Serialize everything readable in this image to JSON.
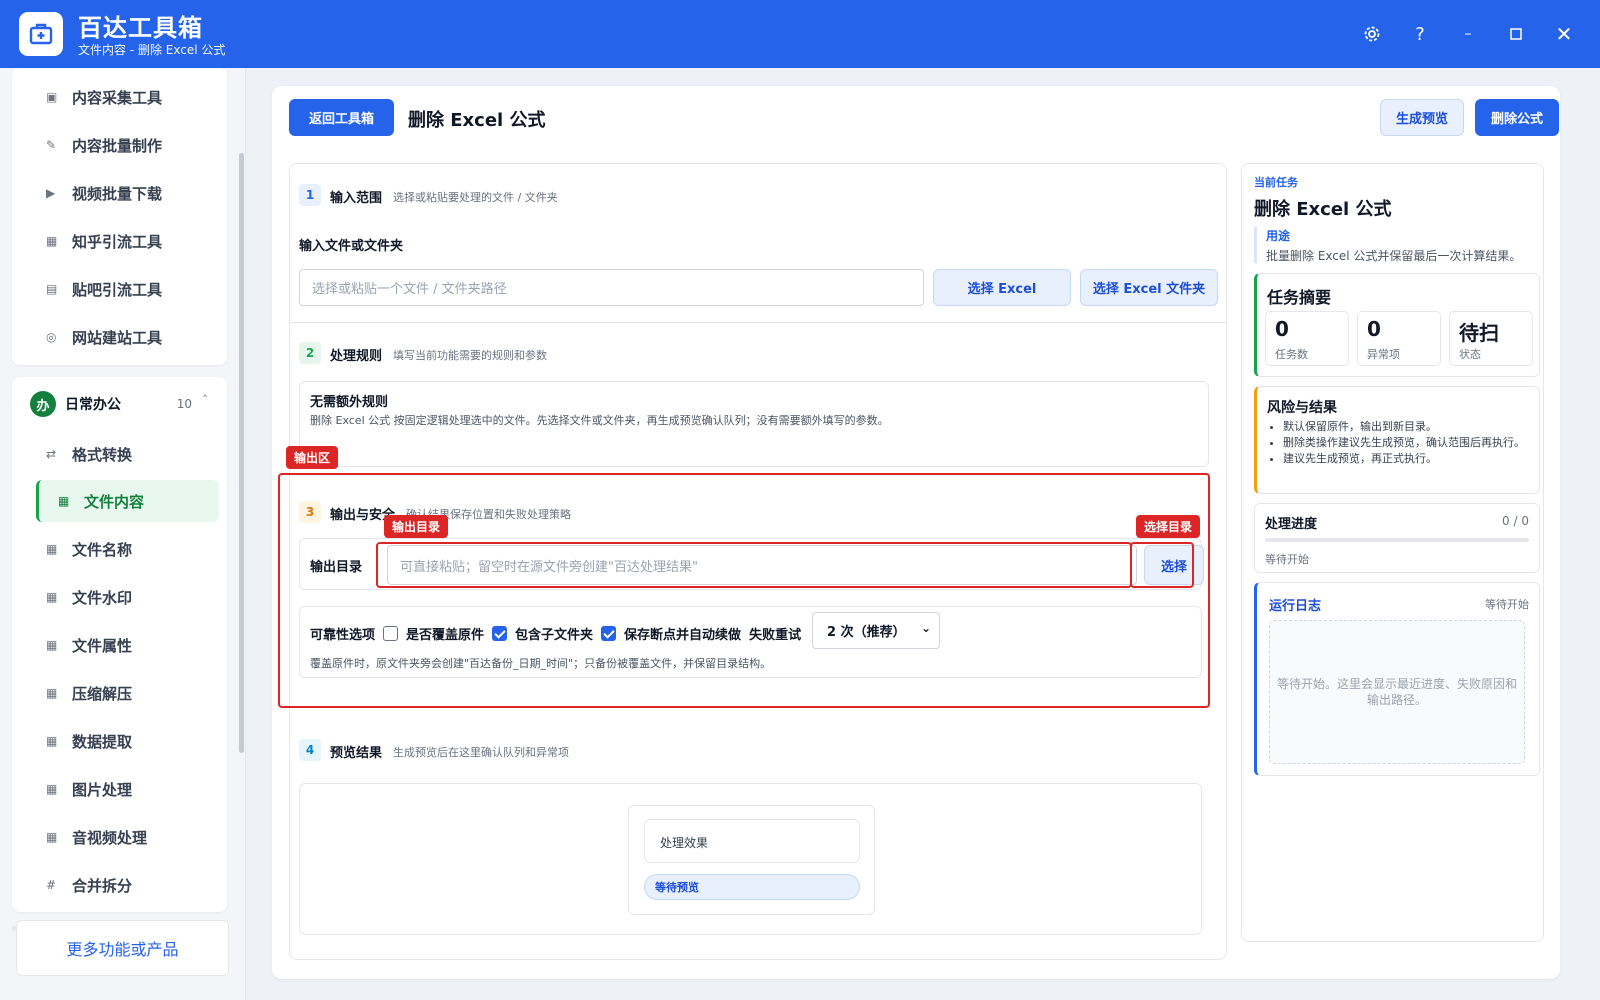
{
  "app": {
    "name": "百达工具箱",
    "subtitle": "文件内容 - 删除 Excel 公式"
  },
  "sidebar": {
    "top_items": [
      {
        "label": "内容采集工具",
        "icon": "▣"
      },
      {
        "label": "内容批量制作",
        "icon": "✎"
      },
      {
        "label": "视频批量下载",
        "icon": "▶"
      },
      {
        "label": "知乎引流工具",
        "icon": "▦"
      },
      {
        "label": "贴吧引流工具",
        "icon": "▤"
      },
      {
        "label": "网站建站工具",
        "icon": "◎"
      }
    ],
    "group": {
      "badge": "办",
      "title": "日常办公",
      "count": "10",
      "caret": "˄"
    },
    "group_items": [
      {
        "label": "格式转换",
        "icon": "⇄"
      },
      {
        "label": "文件内容",
        "icon": "▦"
      },
      {
        "label": "文件名称",
        "icon": "▦"
      },
      {
        "label": "文件水印",
        "icon": "▦"
      },
      {
        "label": "文件属性",
        "icon": "▦"
      },
      {
        "label": "压缩解压",
        "icon": "▦"
      },
      {
        "label": "数据提取",
        "icon": "▦"
      },
      {
        "label": "图片处理",
        "icon": "▦"
      },
      {
        "label": "音视频处理",
        "icon": "▦"
      },
      {
        "label": "合并拆分",
        "icon": "#"
      }
    ],
    "more_label": "更多功能或产品"
  },
  "toolbar": {
    "back_label": "返回工具箱",
    "title": "删除 Excel 公式",
    "preview_label": "生成预览",
    "run_label": "删除公式"
  },
  "sections": {
    "input": {
      "num": "1",
      "title": "输入范围",
      "desc": "选择或粘贴要处理的文件 / 文件夹",
      "field_label": "输入文件或文件夹",
      "placeholder": "选择或粘贴一个文件 / 文件夹路径",
      "pick_file_label": "选择 Excel",
      "pick_folder_label": "选择 Excel 文件夹"
    },
    "rules": {
      "num": "2",
      "title": "处理规则",
      "desc": "填写当前功能需要的规则和参数",
      "box_title": "无需额外规则",
      "box_text": "删除 Excel 公式 按固定逻辑处理选中的文件。先选择文件或文件夹，再生成预览确认队列；没有需要额外填写的参数。"
    },
    "output": {
      "num": "3",
      "title": "输出与安全",
      "desc": "确认结果保存位置和失败处理策略",
      "dir_label": "输出目录",
      "dir_placeholder": "可直接粘贴；留空时在源文件旁创建\"百达处理结果\"",
      "pick_label": "选择",
      "options_label": "可靠性选项",
      "overwrite_label": "是否覆盖原件",
      "overwrite": false,
      "subfolder_label": "包含子文件夹",
      "subfolder": true,
      "resume_label": "保存断点并自动续做",
      "resume": true,
      "retry_label": "失败重试",
      "retry_value": "2 次（推荐）",
      "note": "覆盖原件时，原文件夹旁会创建\"百达备份_日期_时间\"；只备份被覆盖文件，并保留目录结构。"
    },
    "preview": {
      "num": "4",
      "title": "预览结果",
      "desc": "生成预览后在这里确认队列和异常项",
      "effect_label": "处理效果",
      "status_pill": "等待预览"
    }
  },
  "annotations": {
    "output_area": "输出区",
    "output_dir": "输出目录",
    "pick_dir": "选择目录"
  },
  "right": {
    "kicker": "当前任务",
    "title": "删除 Excel 公式",
    "usage_label": "用途",
    "usage_text": "批量删除 Excel 公式并保留最后一次计算结果。",
    "summary_title": "任务摘要",
    "stats": [
      {
        "value": "0",
        "label": "任务数"
      },
      {
        "value": "0",
        "label": "异常项"
      },
      {
        "value": "待扫",
        "label": "状态"
      }
    ],
    "risk_title": "风险与结果",
    "risks": [
      "默认保留原件，输出到新目录。",
      "删除类操作建议先生成预览，确认范围后再执行。",
      "建议先生成预览，再正式执行。"
    ],
    "progress_title": "处理进度",
    "progress_value": "0 / 0",
    "progress_fraction": 0,
    "progress_status": "等待开始",
    "log_title": "运行日志",
    "log_status": "等待开始",
    "log_text": "等待开始。这里会显示最近进度、失败原因和输出路径。"
  },
  "colors": {
    "accent": "#2563eb",
    "success": "#16a34a",
    "danger": "#dc2626",
    "warning": "#f59e0b"
  }
}
